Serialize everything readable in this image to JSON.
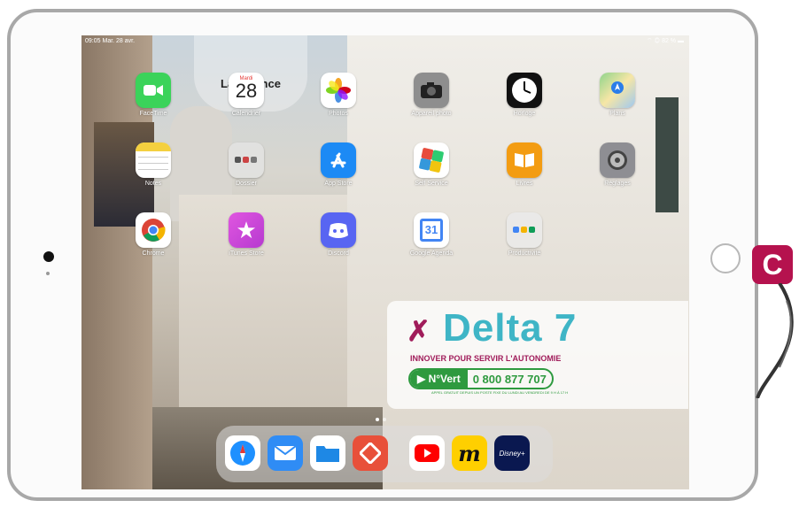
{
  "status": {
    "time": "09:05",
    "date": "Mar. 28 avr.",
    "battery": "82 %"
  },
  "widget": {
    "title": "La Science"
  },
  "apps": [
    {
      "name": "facetime-app",
      "label": "FaceTime",
      "color": "#3bd35a"
    },
    {
      "name": "calendar-app",
      "label": "Calendrier",
      "day_label": "Mardi",
      "day_num": "28"
    },
    {
      "name": "photos-app",
      "label": "Photos"
    },
    {
      "name": "camera-app",
      "label": "Appareil photo",
      "color": "#8e8e8e"
    },
    {
      "name": "clock-app",
      "label": "Horloge",
      "color": "#111111"
    },
    {
      "name": "maps-app",
      "label": "Plans"
    },
    {
      "name": "notes-app",
      "label": "Notes",
      "color": "#f4d03f"
    },
    {
      "name": "folder-app",
      "label": "Dossier"
    },
    {
      "name": "appstore-app",
      "label": "App Store",
      "color": "#1c8af5"
    },
    {
      "name": "selfservice-app",
      "label": "Self Service"
    },
    {
      "name": "books-app",
      "label": "Livres",
      "color": "#f39c12"
    },
    {
      "name": "settings-app",
      "label": "Réglages",
      "color": "#8e8e93"
    },
    {
      "name": "chrome-app",
      "label": "Chrome"
    },
    {
      "name": "itunes-app",
      "label": "iTunes Store",
      "color": "#d84bd8"
    },
    {
      "name": "discord-app",
      "label": "Discord",
      "color": "#5865f2"
    },
    {
      "name": "gcalendar-app",
      "label": "Google Agenda",
      "day": "31"
    },
    {
      "name": "productivity-app",
      "label": "Productivité"
    }
  ],
  "dock": [
    {
      "name": "safari-dock",
      "label": "Safari"
    },
    {
      "name": "mail-dock",
      "label": "Mail"
    },
    {
      "name": "files-dock",
      "label": "Fichiers"
    },
    {
      "name": "anydesk-dock",
      "label": "AnyDesk"
    },
    {
      "name": "youtube-dock",
      "label": "YouTube"
    },
    {
      "name": "mu-dock",
      "label": "m"
    },
    {
      "name": "disney-dock",
      "label": "Disney+"
    }
  ],
  "delta": {
    "logo": "Delta 7",
    "tagline": "INNOVER POUR SERVIR L'AUTONOMIE",
    "nvert_label": "N°Vert",
    "phone": "0 800 877 707",
    "small": "APPEL GRATUIT DEPUIS UN POSTE FIXE DU LUNDI AU VENDREDI DE 9 H À 17 H"
  },
  "badge": {
    "letter": "C",
    "color": "#b5124e"
  }
}
